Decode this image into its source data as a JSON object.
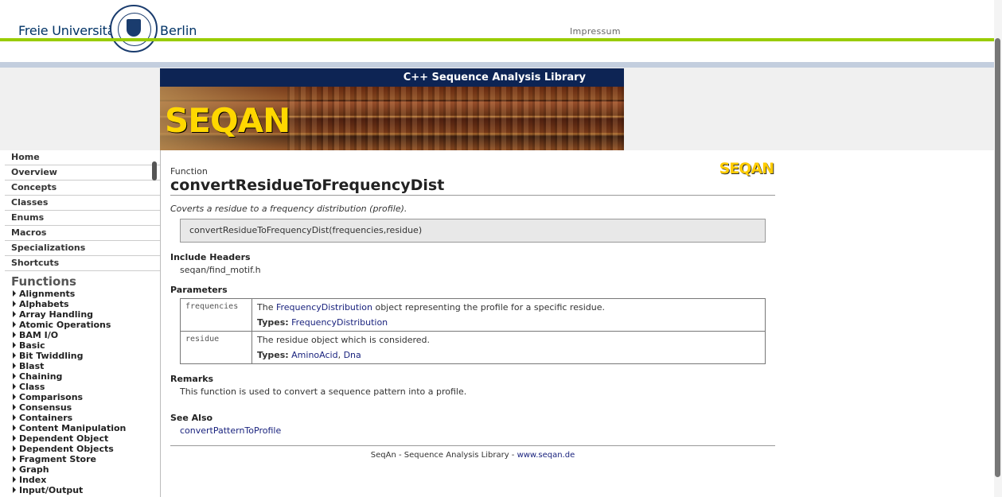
{
  "header": {
    "logo_text_left": "Freie Universität",
    "logo_text_right": "Berlin",
    "impressum": "Impressum"
  },
  "banner": {
    "title": "C++ Sequence Analysis Library",
    "logo": "SEQAN"
  },
  "nav": {
    "items": [
      "Home",
      "Overview",
      "Concepts",
      "Classes",
      "Enums",
      "Macros",
      "Specializations",
      "Shortcuts"
    ],
    "functions_heading": "Functions",
    "function_groups": [
      "Alignments",
      "Alphabets",
      "Array Handling",
      "Atomic Operations",
      "BAM I/O",
      "Basic",
      "Bit Twiddling",
      "Blast",
      "Chaining",
      "Class",
      "Comparisons",
      "Consensus",
      "Containers",
      "Content Manipulation",
      "Dependent Object",
      "Dependent Objects",
      "Fragment Store",
      "Graph",
      "Index",
      "Input/Output"
    ]
  },
  "doc": {
    "kind": "Function",
    "name": "convertResidueToFrequencyDist",
    "logo": "SEQAN",
    "summary": "Coverts a residue to a frequency distribution (profile).",
    "signature": "convertResidueToFrequencyDist(frequencies,residue)",
    "include_heading": "Include Headers",
    "include": "seqan/find_motif.h",
    "params_heading": "Parameters",
    "params": [
      {
        "name": "frequencies",
        "desc_pre": "The ",
        "desc_link": "FrequencyDistribution",
        "desc_post": " object representing the profile for a specific residue.",
        "types_label": "Types:",
        "types": [
          "FrequencyDistribution"
        ]
      },
      {
        "name": "residue",
        "desc": "The residue object which is considered.",
        "types_label": "Types:",
        "types": [
          "AminoAcid",
          "Dna"
        ]
      }
    ],
    "remarks_heading": "Remarks",
    "remarks": "This function is used to convert a sequence pattern into a profile.",
    "seealso_heading": "See Also",
    "seealso": "convertPatternToProfile",
    "footer_text": "SeqAn - Sequence Analysis Library - ",
    "footer_link": "www.seqan.de"
  }
}
